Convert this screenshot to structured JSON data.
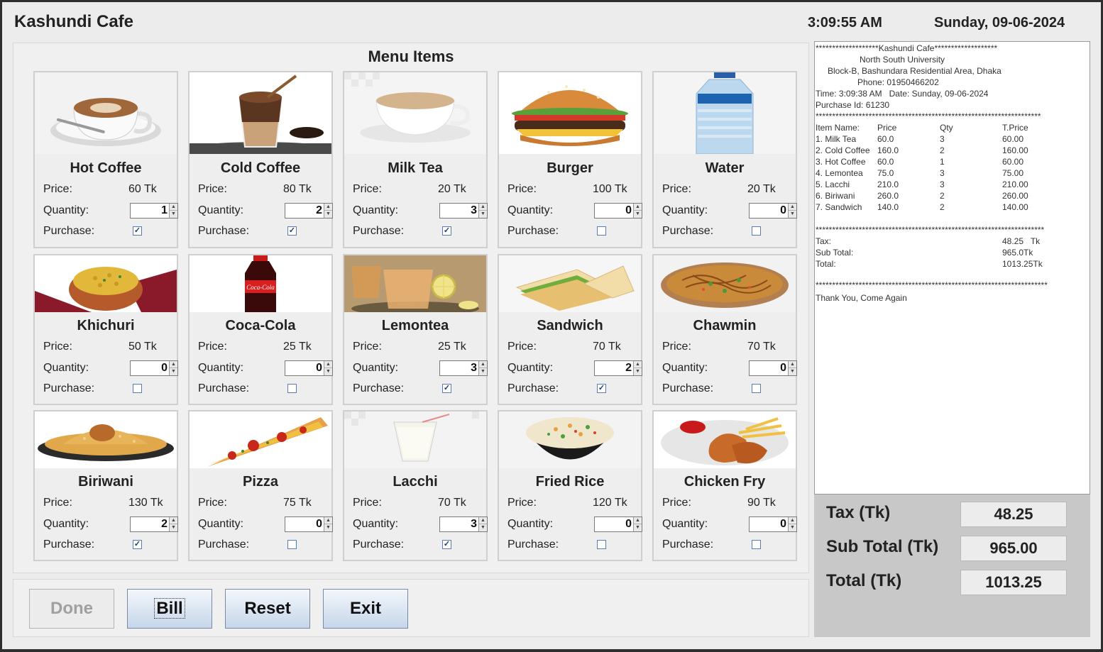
{
  "app": {
    "title": "Kashundi Cafe",
    "time": "3:09:55 AM",
    "date": "Sunday, 09-06-2024"
  },
  "menu": {
    "heading": "Menu Items",
    "labels": {
      "price": "Price:",
      "quantity": "Quantity:",
      "purchase": "Purchase:"
    },
    "items": [
      {
        "name": "Hot Coffee",
        "price": "60 Tk",
        "qty": "1",
        "purchased": "✓",
        "icon": "hot-coffee-image"
      },
      {
        "name": "Cold Coffee",
        "price": "80 Tk",
        "qty": "2",
        "purchased": "✓",
        "icon": "cold-coffee-image"
      },
      {
        "name": "Milk Tea",
        "price": "20 Tk",
        "qty": "3",
        "purchased": "✓",
        "icon": "milk-tea-image"
      },
      {
        "name": "Burger",
        "price": "100 Tk",
        "qty": "0",
        "purchased": "",
        "icon": "burger-image"
      },
      {
        "name": "Water",
        "price": "20 Tk",
        "qty": "0",
        "purchased": "",
        "icon": "water-bottle-image"
      },
      {
        "name": "Khichuri",
        "price": "50 Tk",
        "qty": "0",
        "purchased": "",
        "icon": "khichuri-image"
      },
      {
        "name": "Coca-Cola",
        "price": "25 Tk",
        "qty": "0",
        "purchased": "",
        "icon": "coca-cola-image"
      },
      {
        "name": "Lemontea",
        "price": "25 Tk",
        "qty": "3",
        "purchased": "✓",
        "icon": "lemontea-image"
      },
      {
        "name": "Sandwich",
        "price": "70 Tk",
        "qty": "2",
        "purchased": "✓",
        "icon": "sandwich-image"
      },
      {
        "name": "Chawmin",
        "price": "70 Tk",
        "qty": "0",
        "purchased": "",
        "icon": "chawmin-image"
      },
      {
        "name": "Biriwani",
        "price": "130 Tk",
        "qty": "2",
        "purchased": "✓",
        "icon": "biriwani-image"
      },
      {
        "name": "Pizza",
        "price": "75 Tk",
        "qty": "0",
        "purchased": "",
        "icon": "pizza-image"
      },
      {
        "name": "Lacchi",
        "price": "70 Tk",
        "qty": "3",
        "purchased": "✓",
        "icon": "lacchi-image"
      },
      {
        "name": "Fried Rice",
        "price": "120 Tk",
        "qty": "0",
        "purchased": "",
        "icon": "fried-rice-image"
      },
      {
        "name": "Chicken Fry",
        "price": "90 Tk",
        "qty": "0",
        "purchased": "",
        "icon": "chicken-fry-image"
      }
    ]
  },
  "buttons": {
    "done": "Done",
    "bill": "Bill",
    "reset": "Reset",
    "exit": "Exit"
  },
  "receipt": {
    "header": "*******************Kashundi Cafe*******************",
    "university": "North South University",
    "address": "Block-B, Bashundara Residential Area, Dhaka",
    "phone": "Phone: 01950466202",
    "time_line": "Time: 3:09:38 AM   Date: Sunday, 09-06-2024",
    "purchase_id": "Purchase Id: 61230",
    "separator1": "********************************************************************",
    "columns": {
      "item": "Item Name:",
      "price": "Price",
      "qty": "Qty",
      "total": "T.Price"
    },
    "lines": [
      {
        "item": "1. Milk Tea",
        "price": "60.0",
        "qty": "3",
        "total": "60.00"
      },
      {
        "item": "2. Cold Coffee",
        "price": "160.0",
        "qty": "2",
        "total": "160.00"
      },
      {
        "item": "3. Hot Coffee",
        "price": "60.0",
        "qty": "1",
        "total": "60.00"
      },
      {
        "item": "4. Lemontea",
        "price": "75.0",
        "qty": "3",
        "total": "75.00"
      },
      {
        "item": "5. Lacchi",
        "price": "210.0",
        "qty": "3",
        "total": "210.00"
      },
      {
        "item": "6. Biriwani",
        "price": "260.0",
        "qty": "2",
        "total": "260.00"
      },
      {
        "item": "7. Sandwich",
        "price": "140.0",
        "qty": "2",
        "total": "140.00"
      }
    ],
    "separator2": "*********************************************************************",
    "tax_label": "Tax:",
    "tax_value": "48.25   Tk",
    "subtotal_label": "Sub Total:",
    "subtotal_value": "965.0Tk",
    "total_label": "Total:",
    "total_value": "1013.25Tk",
    "separator3": "**********************************************************************",
    "footer": "Thank You, Come Again"
  },
  "totals": {
    "tax_label": "Tax (Tk)",
    "tax_value": "48.25",
    "subtotal_label": "Sub Total (Tk)",
    "subtotal_value": "965.00",
    "total_label": "Total (Tk)",
    "total_value": "1013.25"
  }
}
